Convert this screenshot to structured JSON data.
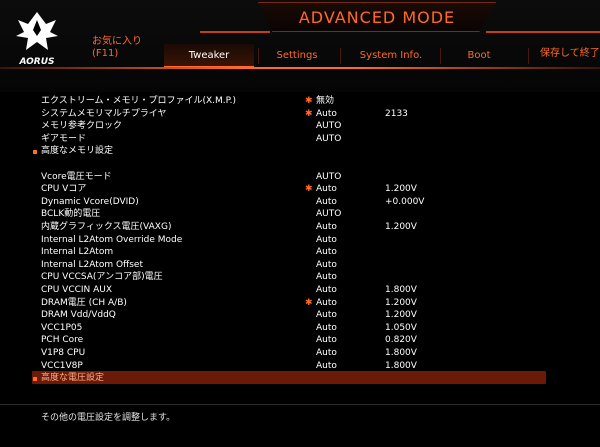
{
  "header": {
    "mode_title": "ADVANCED MODE",
    "favorites_label": "お気に入り",
    "favorites_key": "(F11)",
    "tabs": [
      {
        "label": "Tweaker",
        "active": true
      },
      {
        "label": "Settings",
        "active": false
      },
      {
        "label": "System Info.",
        "active": false
      },
      {
        "label": "Boot",
        "active": false
      }
    ],
    "save_exit": "保存して終了",
    "logo_text": "AORUS"
  },
  "colors": {
    "accent": "#ff6a2a",
    "highlight": "#6a1a06"
  },
  "rows": [
    {
      "label": "エクストリーム・メモリ・プロファイル(X.M.P.)",
      "star": true,
      "value": "無効",
      "value2": ""
    },
    {
      "label": "システムメモリマルチプライヤ",
      "star": true,
      "value": "Auto",
      "value2": "2133"
    },
    {
      "label": "メモリ参考クロック",
      "star": false,
      "value": "AUTO",
      "value2": ""
    },
    {
      "label": "ギアモード",
      "star": false,
      "value": "AUTO",
      "value2": ""
    },
    {
      "label": "高度なメモリ設定",
      "bullet": true,
      "star": false,
      "value": "",
      "value2": ""
    },
    {
      "label": "",
      "star": false,
      "value": "",
      "value2": ""
    },
    {
      "label": "Vcore電圧モード",
      "star": false,
      "value": "AUTO",
      "value2": ""
    },
    {
      "label": "CPU Vコア",
      "star": true,
      "value": "Auto",
      "value2": "1.200V"
    },
    {
      "label": "Dynamic Vcore(DVID)",
      "star": false,
      "value": "Auto",
      "value2": "+0.000V"
    },
    {
      "label": "BCLK動的電圧",
      "star": false,
      "value": "AUTO",
      "value2": ""
    },
    {
      "label": "内蔵グラフィックス電圧(VAXG)",
      "star": false,
      "value": "Auto",
      "value2": "1.200V"
    },
    {
      "label": "Internal L2Atom Override Mode",
      "star": false,
      "value": "Auto",
      "value2": ""
    },
    {
      "label": "Internal L2Atom",
      "star": false,
      "value": "Auto",
      "value2": ""
    },
    {
      "label": "Internal L2Atom Offset",
      "star": false,
      "value": "Auto",
      "value2": ""
    },
    {
      "label": "CPU VCCSA(アンコア部)電圧",
      "star": false,
      "value": "Auto",
      "value2": ""
    },
    {
      "label": "CPU VCCIN AUX",
      "star": false,
      "value": "Auto",
      "value2": "1.800V"
    },
    {
      "label": "DRAM電圧 (CH A/B)",
      "star": true,
      "value": "Auto",
      "value2": "1.200V"
    },
    {
      "label": "DRAM Vdd/VddQ",
      "star": false,
      "value": "Auto",
      "value2": "1.200V"
    },
    {
      "label": "VCC1P05",
      "star": false,
      "value": "Auto",
      "value2": "1.050V"
    },
    {
      "label": "PCH Core",
      "star": false,
      "value": "Auto",
      "value2": "0.820V"
    },
    {
      "label": "V1P8 CPU",
      "star": false,
      "value": "Auto",
      "value2": "1.800V"
    },
    {
      "label": "VCC1V8P",
      "star": false,
      "value": "Auto",
      "value2": "1.800V"
    },
    {
      "label": "高度な電圧設定",
      "bullet": true,
      "highlight": true,
      "star": false,
      "value": "",
      "value2": ""
    }
  ],
  "footer": {
    "help_text": "その他の電圧設定を調整します。"
  }
}
